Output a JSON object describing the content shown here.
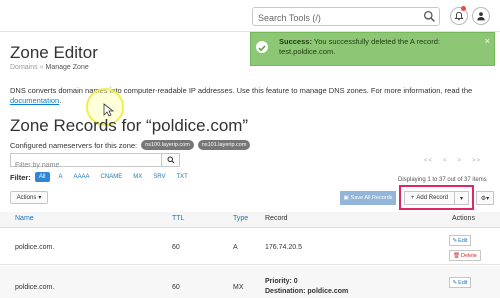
{
  "topbar": {
    "search_placeholder": "Search Tools (/)",
    "search_icon": "search-icon",
    "bell_icon": "bell-icon",
    "user_icon": "user-icon"
  },
  "notice": {
    "strong": "Success:",
    "message": "You successfully deleted the A record: test.poldice.com.",
    "close": "×",
    "color": "#8dc775"
  },
  "page": {
    "title": "Zone Editor",
    "breadcrumb": [
      "Domains",
      "Manage Zone"
    ],
    "intro": "DNS converts domain names into computer-readable IP addresses. Use this feature to manage DNS zones. For more information, read the",
    "intro_link": "documentation",
    "intro_end": "."
  },
  "records": {
    "heading": "Zone Records for “poldice.com”",
    "ns_label": "Configured nameservers for this zone:",
    "nameservers": [
      "ns100.layerip.com",
      "ns101.layerip.com"
    ],
    "filter_placeholder": "Filter by name",
    "pager": [
      "<<",
      "<",
      ">",
      ">>"
    ],
    "filter_label": "Filter:",
    "filters": [
      "All",
      "A",
      "AAAA",
      "CNAME",
      "MX",
      "SRV",
      "TXT"
    ],
    "active_filter": "All",
    "displaying": "Displaying 1 to 37 out of 37 items",
    "actions_label": "Actions",
    "save_all_label": "Save All Records",
    "add_record_label": "Add Record",
    "highlight_color": "#e02763"
  },
  "table": {
    "columns": [
      "Name",
      "TTL",
      "Type",
      "Record",
      "Actions"
    ],
    "rows": [
      {
        "name": "poldice.com.",
        "ttl": "60",
        "type": "A",
        "record": "176.74.20.5",
        "record2": ""
      },
      {
        "name": "poldice.com.",
        "ttl": "60",
        "type": "MX",
        "record": "Priority: 0",
        "record2": "Destination: poldice.com"
      }
    ],
    "edit_label": "Edit",
    "delete_label": "Delete"
  }
}
